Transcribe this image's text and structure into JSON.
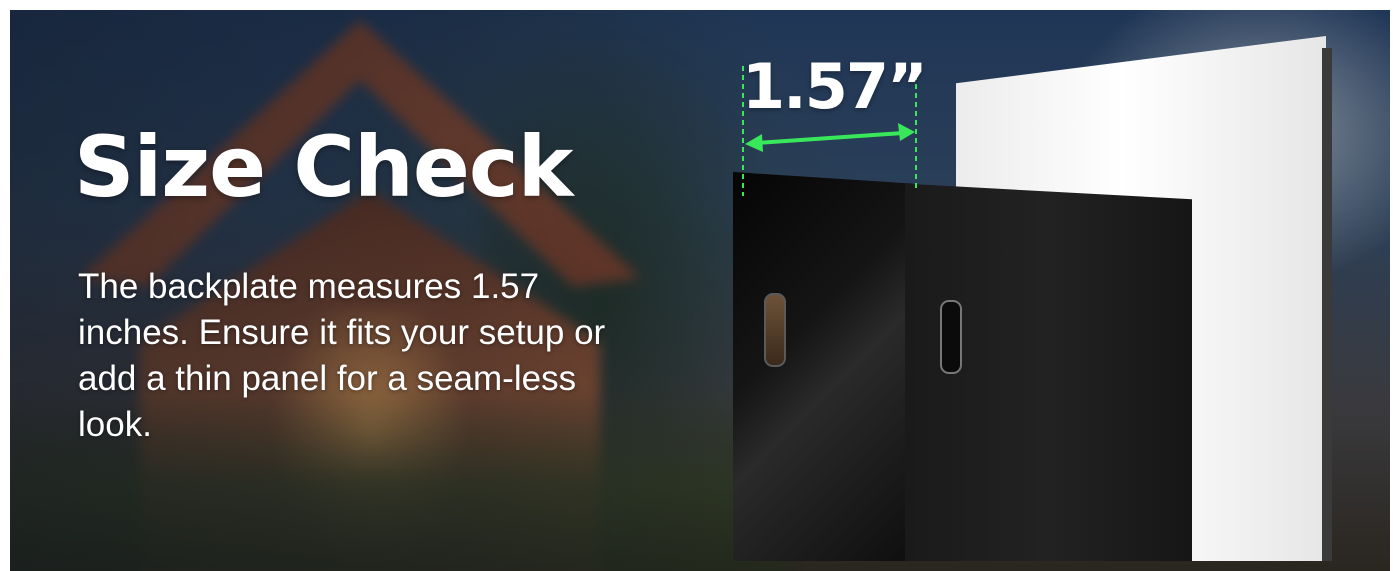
{
  "banner": {
    "title": "Size Check",
    "description": "The backplate measures 1.57 inches. Ensure it fits your setup or add a thin panel for a seam-less look.",
    "dimension_label": "1.57”",
    "accent_color": "#39e85a"
  }
}
